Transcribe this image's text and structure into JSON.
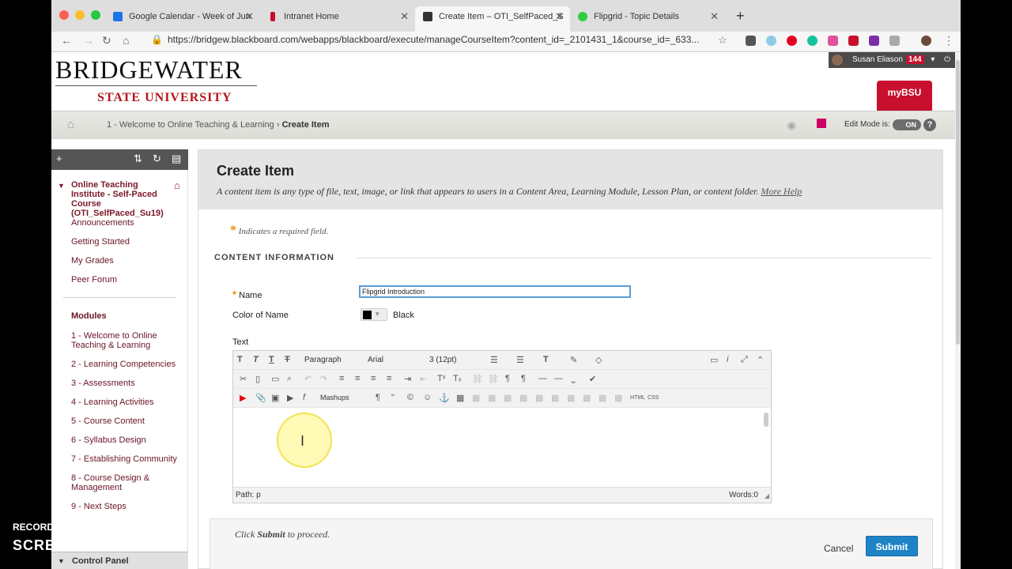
{
  "browser": {
    "tabs": [
      {
        "label": "Google Calendar - Week of Jun",
        "color": "#1a73e8"
      },
      {
        "label": "Intranet Home",
        "color": "#c8102e"
      },
      {
        "label": "Create Item – OTI_SelfPaced_S",
        "color": "#333333"
      },
      {
        "label": "Flipgrid - Topic Details",
        "color": "#2ecc40"
      }
    ],
    "url": "https://bridgew.blackboard.com/webapps/blackboard/execute/manageCourseItem?content_id=_2101431_1&course_id=_633..."
  },
  "brand": {
    "line1": "BRIDGEWATER",
    "line2": "STATE UNIVERSITY",
    "portal": "myBSU"
  },
  "user": {
    "name": "Susan Eliason",
    "count": "144"
  },
  "breadcrumb": {
    "parent": "1 - Welcome to Online Teaching & Learning",
    "separator": "›",
    "current": "Create Item"
  },
  "edit_mode": {
    "label": "Edit Mode is:",
    "state": "ON"
  },
  "sidebar": {
    "course": "Online Teaching Institute - Self-Paced Course (OTI_SelfPaced_Su19)",
    "links": [
      "Announcements",
      "Getting Started",
      "My Grades",
      "Peer Forum"
    ],
    "modules_heading": "Modules",
    "modules": [
      "1 - Welcome to Online Teaching & Learning",
      "2 - Learning Competencies",
      "3 - Assessments",
      "4 - Learning Activities",
      "5 - Course Content",
      "6 - Syllabus Design",
      "7 - Establishing Community",
      "8 - Course Design & Management",
      "9 - Next Steps"
    ],
    "control_panel": "Control Panel"
  },
  "main": {
    "title": "Create Item",
    "description": "A content item is any type of file, text, image, or link that appears to users in a Content Area, Learning Module, Lesson Plan, or content folder.",
    "more_help": "More Help",
    "required_note": "Indicates a required field.",
    "section": "CONTENT INFORMATION",
    "name_label": "Name",
    "name_value": "Flipgrid Introduction",
    "color_label": "Color of Name",
    "color_value": "Black",
    "text_label": "Text",
    "editor": {
      "paragraph": "Paragraph",
      "font": "Arial",
      "size": "3 (12pt)",
      "mashups": "Mashups",
      "path": "Path: p",
      "words": "Words:0"
    },
    "proceed_prefix": "Click",
    "proceed_bold": "Submit",
    "proceed_suffix": "to proceed.",
    "cancel": "Cancel",
    "submit": "Submit"
  },
  "watermark": {
    "line1": "RECORDED WITH",
    "line2": "SCREENCAST-O-MATIC"
  }
}
